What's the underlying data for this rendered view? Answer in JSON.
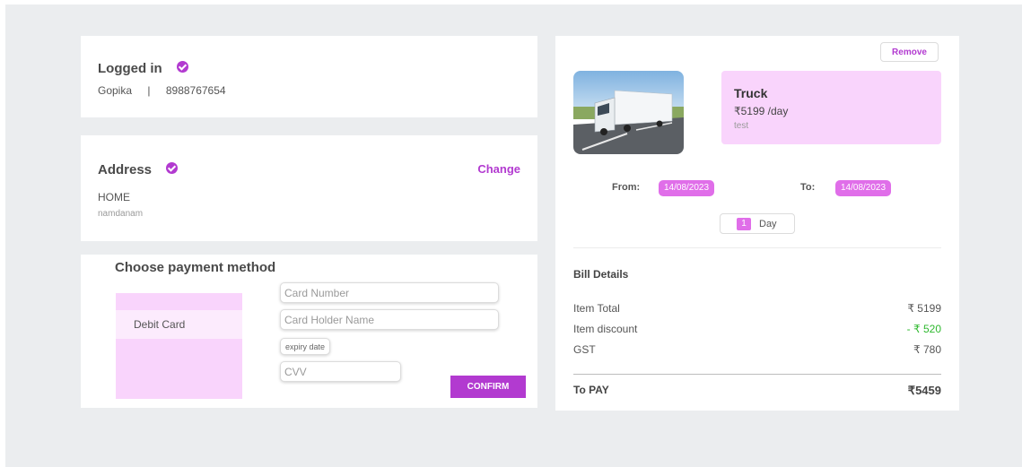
{
  "login": {
    "title": "Logged in",
    "name": "Gopika",
    "separator": "|",
    "phone": "8988767654"
  },
  "address": {
    "title": "Address",
    "change_label": "Change",
    "type": "HOME",
    "line": "namdanam"
  },
  "payment": {
    "title": "Choose payment method",
    "method": "Debit Card",
    "card_number_placeholder": "Card Number",
    "card_holder_placeholder": "Card Holder Name",
    "expiry_label": "expiry date",
    "cvv_placeholder": "CVV",
    "confirm_label": "CONFIRM"
  },
  "item": {
    "remove_label": "Remove",
    "name": "Truck",
    "price": "₹5199 /day",
    "description": "test",
    "from_label": "From:",
    "from_date": "14/08/2023",
    "to_label": "To:",
    "to_date": "14/08/2023",
    "days_count": "1",
    "days_label": "Day"
  },
  "bill": {
    "title": "Bill Details",
    "rows": [
      {
        "label": "Item Total",
        "value": "₹ 5199"
      },
      {
        "label": "Item discount",
        "value": "- ₹ 520"
      },
      {
        "label": "GST",
        "value": "₹ 780"
      }
    ],
    "total_label": "To PAY",
    "total_value": "₹5459"
  },
  "colors": {
    "accent": "#b23ad0",
    "light_pink": "#f9d4fc",
    "date_pink": "#e06ee9",
    "discount_green": "#2eb82e"
  }
}
